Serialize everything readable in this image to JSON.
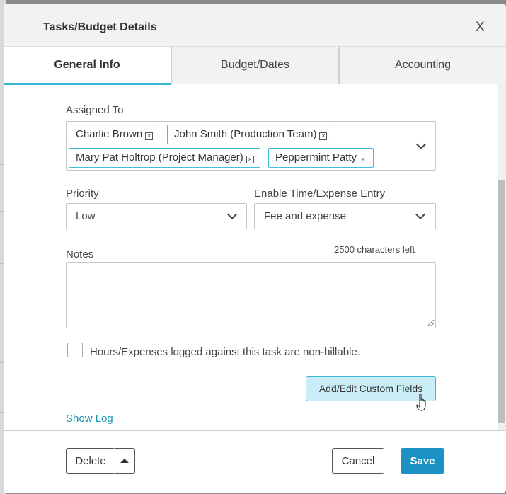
{
  "dialog": {
    "title": "Tasks/Budget Details",
    "close_label": "X"
  },
  "tabs": [
    {
      "label": "General Info",
      "active": true
    },
    {
      "label": "Budget/Dates",
      "active": false
    },
    {
      "label": "Accounting",
      "active": false
    }
  ],
  "assigned_to": {
    "label": "Assigned To",
    "chips": [
      "Charlie Brown",
      "John Smith (Production Team)",
      "Mary Pat Holtrop (Project Manager)",
      "Peppermint Patty"
    ],
    "remove_glyph": "×"
  },
  "priority": {
    "label": "Priority",
    "value": "Low"
  },
  "time_expense": {
    "label": "Enable Time/Expense Entry",
    "value": "Fee and expense"
  },
  "notes": {
    "label": "Notes",
    "counter": "2500 characters left",
    "value": ""
  },
  "non_billable": {
    "label": "Hours/Expenses logged against this task are non-billable.",
    "checked": false
  },
  "custom_fields_button": "Add/Edit Custom Fields",
  "show_log": "Show Log",
  "footer": {
    "delete_label": "Delete",
    "cancel_label": "Cancel",
    "save_label": "Save"
  },
  "colors": {
    "accent": "#3ab7d6",
    "primary_button": "#1a93c4",
    "link": "#1a93b8"
  }
}
